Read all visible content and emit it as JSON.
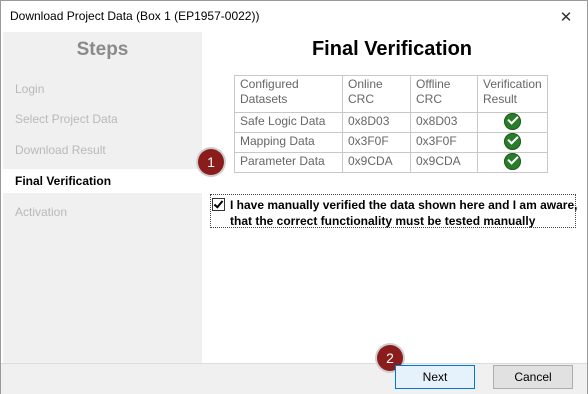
{
  "window": {
    "title": "Download Project Data (Box 1 (EP1957-0022))",
    "close_glyph": "✕"
  },
  "sidebar": {
    "heading": "Steps",
    "items": [
      {
        "label": "Login",
        "active": false
      },
      {
        "label": "Select Project Data",
        "active": false
      },
      {
        "label": "Download Result",
        "active": false
      },
      {
        "label": "Final Verification",
        "active": true
      },
      {
        "label": "Activation",
        "active": false
      }
    ]
  },
  "main": {
    "title": "Final Verification",
    "table": {
      "headers": [
        [
          "Configured",
          "Datasets"
        ],
        [
          "Online",
          "CRC"
        ],
        [
          "Offline",
          "CRC"
        ],
        [
          "Verification",
          "Result"
        ]
      ],
      "rows": [
        {
          "dataset": "Safe Logic Data",
          "online": "0x8D03",
          "offline": "0x8D03",
          "result_icon": "green-check-icon"
        },
        {
          "dataset": "Mapping Data",
          "online": "0x3F0F",
          "offline": "0x3F0F",
          "result_icon": "green-check-icon"
        },
        {
          "dataset": "Parameter Data",
          "online": "0x9CDA",
          "offline": "0x9CDA",
          "result_icon": "green-check-icon"
        }
      ]
    },
    "verification": {
      "checked": true,
      "label": "I have manually verified the data shown here and I am aware, that the correct functionality must be tested manually"
    }
  },
  "callouts": {
    "one": "1",
    "two": "2"
  },
  "footer": {
    "next_label": "Next",
    "cancel_label": "Cancel"
  },
  "colors": {
    "badge": "#8b1c1c",
    "check": "#2a7c2a",
    "active_step_bg": "#ffffff",
    "sidebar_bg": "#f0f0f0"
  }
}
